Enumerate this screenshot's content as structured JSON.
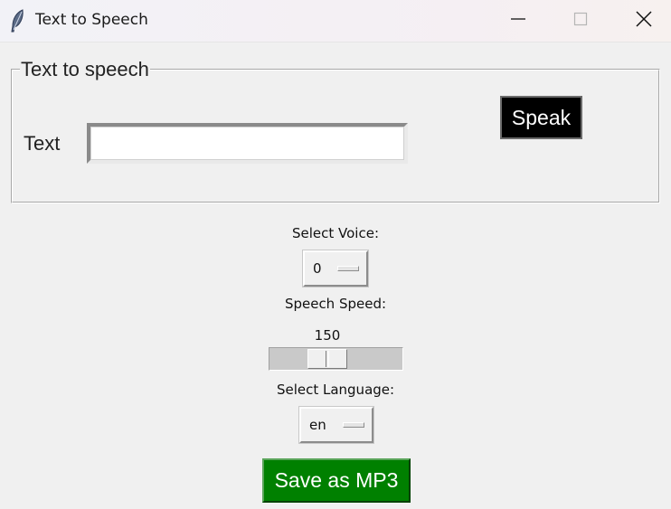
{
  "window": {
    "title": "Text to Speech",
    "icon": "feather-icon",
    "controls": [
      "minimize-icon",
      "maximize-icon",
      "close-icon"
    ]
  },
  "frame": {
    "legend": "Text to speech",
    "text_label": "Text",
    "text_value": "",
    "speak_label": "Speak"
  },
  "voice": {
    "label": "Select Voice:",
    "selected": "0"
  },
  "speed": {
    "label": "Speech Speed:",
    "value": "150"
  },
  "language": {
    "label": "Select Language:",
    "selected": "en"
  },
  "save": {
    "label": "Save as MP3"
  },
  "colors": {
    "background": "#f0f0f0",
    "speak_button": "#000000",
    "save_button": "#008000",
    "button_text": "#ffffff"
  }
}
